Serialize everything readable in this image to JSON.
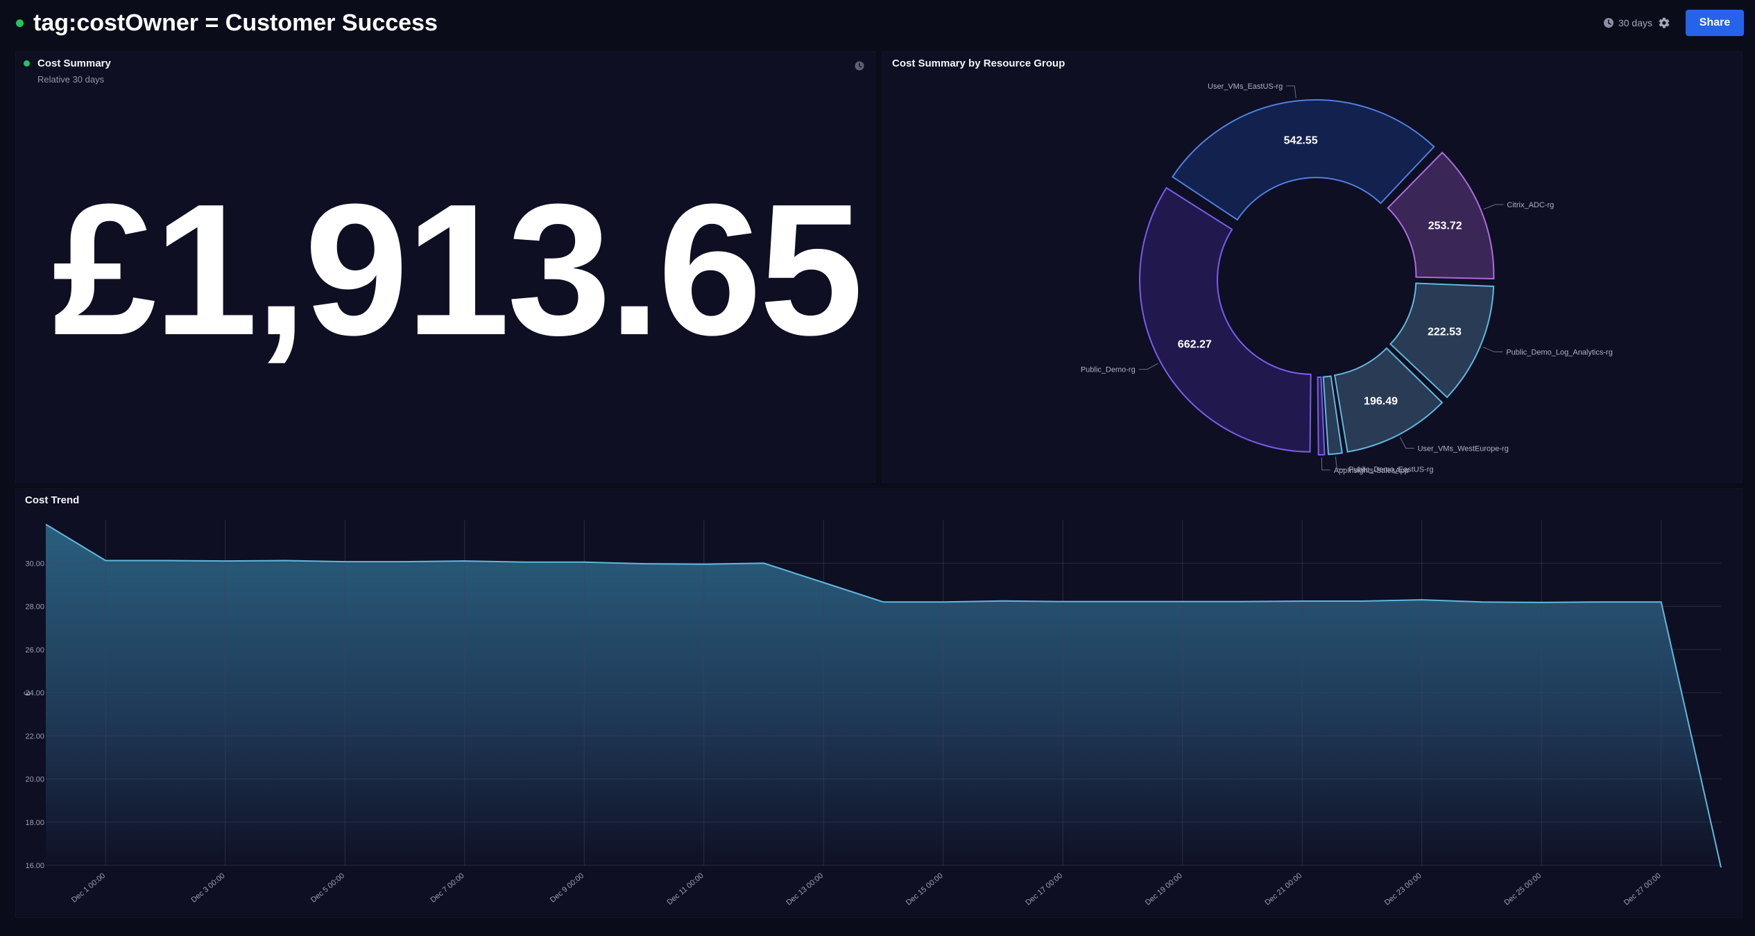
{
  "page": {
    "title": "tag:costOwner = Customer Success"
  },
  "controls": {
    "time_range": "30 days",
    "share_label": "Share",
    "time_icon": "clock-icon",
    "settings_icon": "gear-icon"
  },
  "colors": {
    "accent": "#2563eb",
    "status_live": "#22c55e",
    "trend_line": "#60b8e0"
  },
  "summary": {
    "title": "Cost Summary",
    "subtitle": "Relative 30 days",
    "value": "£1,913.65"
  },
  "donut": {
    "title": "Cost Summary by Resource Group"
  },
  "trend": {
    "title": "Cost Trend"
  },
  "chart_data": [
    {
      "type": "pie",
      "title": "Cost Summary by Resource Group",
      "categories": [
        "Public_Demo-rg",
        "User_VMs_EastUS-rg",
        "Citrix_ADC-rg",
        "Public_Demo_Log_Analytics-rg",
        "User_VMs_WestEurope-rg",
        "Public_Demo_EastUS-rg",
        "AppInsights-SalesApp"
      ],
      "values": [
        662.27,
        542.55,
        253.72,
        222.53,
        196.49,
        25,
        11
      ],
      "value_labels": [
        "662.27",
        "542.55",
        "253.72",
        "222.53",
        "196.49",
        "",
        ""
      ],
      "colors": {
        "fill": [
          "#21194d",
          "#12214d",
          "#3a2757",
          "#293b55",
          "#293b55",
          "#293b55",
          "#291f5c"
        ],
        "stroke": [
          "#7a5cf0",
          "#4f7fe3",
          "#b06be0",
          "#60b8e0",
          "#60b8e0",
          "#60b8e0",
          "#7a5cf0"
        ]
      }
    },
    {
      "type": "area",
      "title": "Cost Trend",
      "ylabel": "£",
      "x": [
        "Dec 1",
        "Dec 2",
        "Dec 3",
        "Dec 4",
        "Dec 5",
        "Dec 6",
        "Dec 7",
        "Dec 8",
        "Dec 9",
        "Dec 10",
        "Dec 11",
        "Dec 12",
        "Dec 13",
        "Dec 14",
        "Dec 15",
        "Dec 16",
        "Dec 17",
        "Dec 18",
        "Dec 19",
        "Dec 20",
        "Dec 21",
        "Dec 22",
        "Dec 23",
        "Dec 24",
        "Dec 25",
        "Dec 26",
        "Dec 27",
        "Dec 28",
        "Dec 29"
      ],
      "values": [
        31.8,
        30.12,
        30.12,
        30.1,
        30.12,
        30.07,
        30.07,
        30.1,
        30.05,
        30.05,
        29.97,
        29.95,
        30.0,
        29.1,
        28.2,
        28.2,
        28.25,
        28.22,
        28.22,
        28.22,
        28.22,
        28.24,
        28.24,
        28.3,
        28.2,
        28.18,
        28.2,
        28.2,
        15.9
      ],
      "ylim": [
        16,
        32
      ],
      "yticks": [
        "16.00",
        "18.00",
        "20.00",
        "22.00",
        "24.00",
        "26.00",
        "28.00",
        "30.00"
      ],
      "xticks": [
        "Dec 1 00:00",
        "Dec 3 00:00",
        "Dec 5 00:00",
        "Dec 7 00:00",
        "Dec 9 00:00",
        "Dec 11 00:00",
        "Dec 13 00:00",
        "Dec 15 00:00",
        "Dec 17 00:00",
        "Dec 19 00:00",
        "Dec 21 00:00",
        "Dec 23 00:00",
        "Dec 25 00:00",
        "Dec 27 00:00"
      ],
      "grid": true,
      "legend": "none"
    }
  ]
}
